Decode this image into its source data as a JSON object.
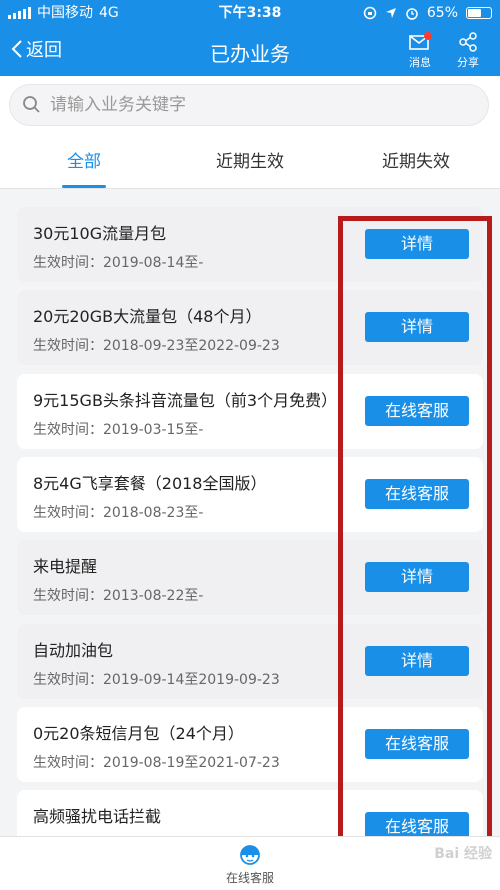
{
  "status_bar": {
    "carrier": "中国移动",
    "network": "4G",
    "time": "下午3:38",
    "battery": "65%",
    "battery_level": 0.65
  },
  "nav": {
    "back_label": "返回",
    "title": "已办业务",
    "messages_label": "消息",
    "share_label": "分享",
    "message_badge_color": "#ff3b30"
  },
  "search": {
    "placeholder": "请输入业务关键字"
  },
  "tabs": [
    {
      "label": "全部",
      "active": true
    },
    {
      "label": "近期生效",
      "active": false
    },
    {
      "label": "近期失效",
      "active": false
    }
  ],
  "colors": {
    "accent": "#1a8fe8",
    "highlight_frame": "#b71c1c"
  },
  "services": [
    {
      "name": "30元10G流量月包",
      "date": "生效时间：2019-08-14至-",
      "action": "详情"
    },
    {
      "name": "20元20GB大流量包（48个月）",
      "date": "生效时间：2018-09-23至2022-09-23",
      "action": "详情"
    },
    {
      "name": "9元15GB头条抖音流量包（前3个月免费）",
      "date": "生效时间：2019-03-15至-",
      "action": "在线客服"
    },
    {
      "name": "8元4G飞享套餐（2018全国版）",
      "date": "生效时间：2018-08-23至-",
      "action": "在线客服"
    },
    {
      "name": "来电提醒",
      "date": "生效时间：2013-08-22至-",
      "action": "详情"
    },
    {
      "name": "自动加油包",
      "date": "生效时间：2019-09-14至2019-09-23",
      "action": "详情"
    },
    {
      "name": "0元20条短信月包（24个月）",
      "date": "生效时间：2019-08-19至2021-07-23",
      "action": "在线客服"
    },
    {
      "name": "高频骚扰电话拦截",
      "date": "",
      "action": "在线客服"
    }
  ],
  "bottom": {
    "chat_label": "在线客服"
  },
  "watermark": "Bai 经验"
}
